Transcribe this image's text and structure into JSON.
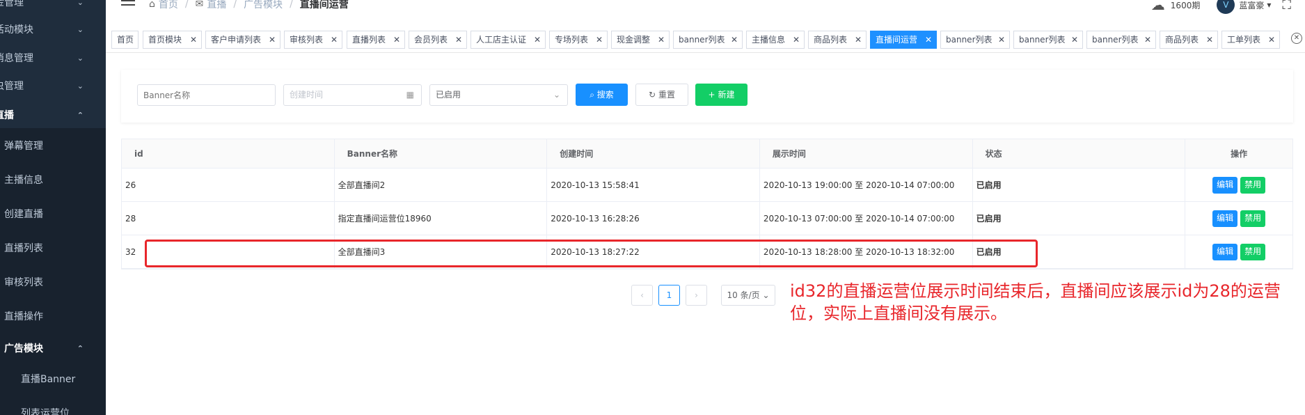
{
  "sidebar": {
    "items": [
      {
        "label": "金管理",
        "chev": "⌄"
      },
      {
        "label": "活动模块",
        "chev": "⌄"
      },
      {
        "label": "消息管理",
        "chev": "⌄"
      },
      {
        "label": "虫管理",
        "chev": "⌄"
      },
      {
        "label": "直播",
        "chev": "⌃"
      },
      {
        "label": "弹幕管理"
      },
      {
        "label": "主播信息"
      },
      {
        "label": "创建直播"
      },
      {
        "label": "直播列表"
      },
      {
        "label": "审核列表"
      },
      {
        "label": "直播操作"
      },
      {
        "label": "广告模块",
        "chev": "⌃"
      },
      {
        "label": "直播Banner"
      },
      {
        "label": "列表运营位"
      }
    ]
  },
  "header": {
    "breadcrumbs": [
      "首页",
      "直播",
      "广告模块",
      "直播间运营"
    ],
    "downloads": "1600期",
    "username": "蓝富豪",
    "avatar_text": "V"
  },
  "tags": [
    {
      "label": "首页",
      "closable": false
    },
    {
      "label": "首页模块",
      "closable": true
    },
    {
      "label": "客户申请列表",
      "closable": true
    },
    {
      "label": "审核列表",
      "closable": true
    },
    {
      "label": "直播列表",
      "closable": true
    },
    {
      "label": "会员列表",
      "closable": true
    },
    {
      "label": "人工店主认证",
      "closable": true
    },
    {
      "label": "专场列表",
      "closable": true
    },
    {
      "label": "现金调整",
      "closable": true
    },
    {
      "label": "banner列表",
      "closable": true
    },
    {
      "label": "主播信息",
      "closable": true
    },
    {
      "label": "商品列表",
      "closable": true
    },
    {
      "label": "直播间运营",
      "closable": true,
      "active": true
    },
    {
      "label": "banner列表",
      "closable": true
    },
    {
      "label": "banner列表",
      "closable": true
    },
    {
      "label": "banner列表",
      "closable": true
    },
    {
      "label": "商品列表",
      "closable": true
    },
    {
      "label": "工单列表",
      "closable": true
    }
  ],
  "search": {
    "name_placeholder": "Banner名称",
    "time_placeholder": "创建时间",
    "status_value": "已启用",
    "search_label": "搜索",
    "reset_label": "重置",
    "new_label": "新建"
  },
  "table": {
    "headers": [
      "id",
      "Banner名称",
      "创建时间",
      "展示时间",
      "状态",
      "操作"
    ],
    "rows": [
      {
        "id": "26",
        "name": "全部直播间2",
        "created": "2020-10-13 15:58:41",
        "display": "2020-10-13 19:00:00 至 2020-10-14 07:00:00",
        "status": "已启用",
        "edit": "编辑",
        "disable": "禁用"
      },
      {
        "id": "28",
        "name": "指定直播间运营位18960",
        "created": "2020-10-13 16:28:26",
        "display": "2020-10-13 07:00:00 至 2020-10-14 07:00:00",
        "status": "已启用",
        "edit": "编辑",
        "disable": "禁用"
      },
      {
        "id": "32",
        "name": "全部直播间3",
        "created": "2020-10-13 18:27:22",
        "display": "2020-10-13 18:28:00 至 2020-10-13 18:32:00",
        "status": "已启用",
        "edit": "编辑",
        "disable": "禁用"
      }
    ]
  },
  "pagination": {
    "prev": "‹",
    "current": "1",
    "next": "›",
    "page_size": "10 条/页"
  },
  "annotation": {
    "text": "id32的直播运营位展示时间结束后，直播间应该展示id为28的运营位，实际上直播间没有展示。",
    "color": "#e8262b"
  }
}
